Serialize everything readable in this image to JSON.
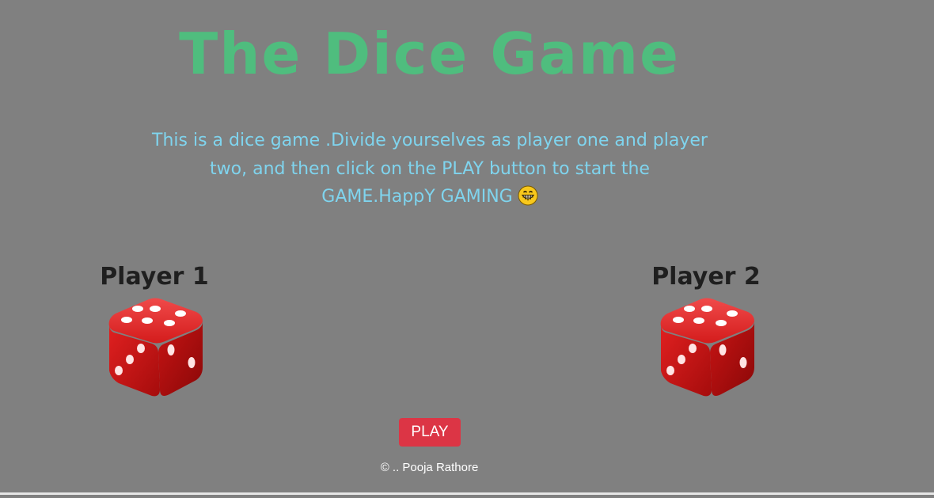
{
  "game": {
    "title": "The Dice Game",
    "intro_text": "This is a dice game .Divide yourselves as player one and player two, and then click on the PLAY button to start the GAME.HappY GAMING",
    "intro_emoji": "grinning-face-icon",
    "players": [
      {
        "label": "Player 1",
        "die_icon": "red-die-icon"
      },
      {
        "label": "Player 2",
        "die_icon": "red-die-icon"
      }
    ],
    "play_button_label": "PLAY",
    "footer_text": "© .. Pooja Rathore"
  },
  "colors": {
    "background": "#808080",
    "title": "#4fbd7e",
    "intro": "#7fd4ee",
    "player_label": "#1f1f1f",
    "play_button": "#dc3545",
    "footer": "#ffffff",
    "die_red": "#d81c1c"
  }
}
